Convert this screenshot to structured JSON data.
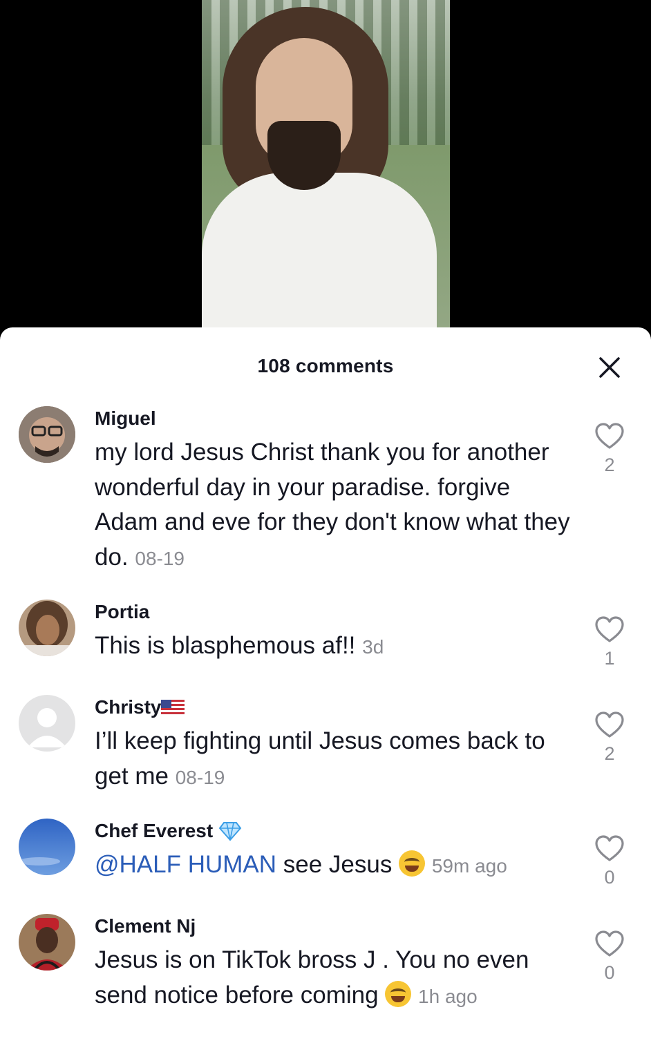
{
  "sheet": {
    "count_label": "108 comments"
  },
  "comments": [
    {
      "username": "Miguel",
      "text": "my lord Jesus Christ thank you for another wonderful day in your paradise. forgive Adam and eve for they don't know what they do.",
      "timestamp": "08-19",
      "likes": "2",
      "avatar_color": "#6b5a4e"
    },
    {
      "username": "Portia",
      "text": "This is blasphemous af!!",
      "timestamp": "3d",
      "likes": "1",
      "avatar_color": "#8a6a52"
    },
    {
      "username": "Christy",
      "text": "I’ll keep fighting until Jesus comes back to get me",
      "timestamp": "08-19",
      "likes": "2",
      "avatar_color": "#d9d9d9"
    },
    {
      "username": "Chef Everest",
      "mention": "@HALF HUMAN",
      "text": "see Jesus",
      "timestamp": "59m ago",
      "likes": "0",
      "avatar_color": "#3f74c9"
    },
    {
      "username": "Clement Nj",
      "text": "Jesus is on TikTok bross J . You no even send notice before coming",
      "timestamp": "1h ago",
      "likes": "0",
      "avatar_color": "#4a3a2e"
    }
  ],
  "icons": {
    "close": "close-icon",
    "like": "heart-outline-icon",
    "verified": "diamond-badge-icon",
    "flag": "us-flag-icon",
    "emoji_rofl": "rofl-emoji-icon",
    "emoji_joy": "joy-emoji-icon"
  }
}
